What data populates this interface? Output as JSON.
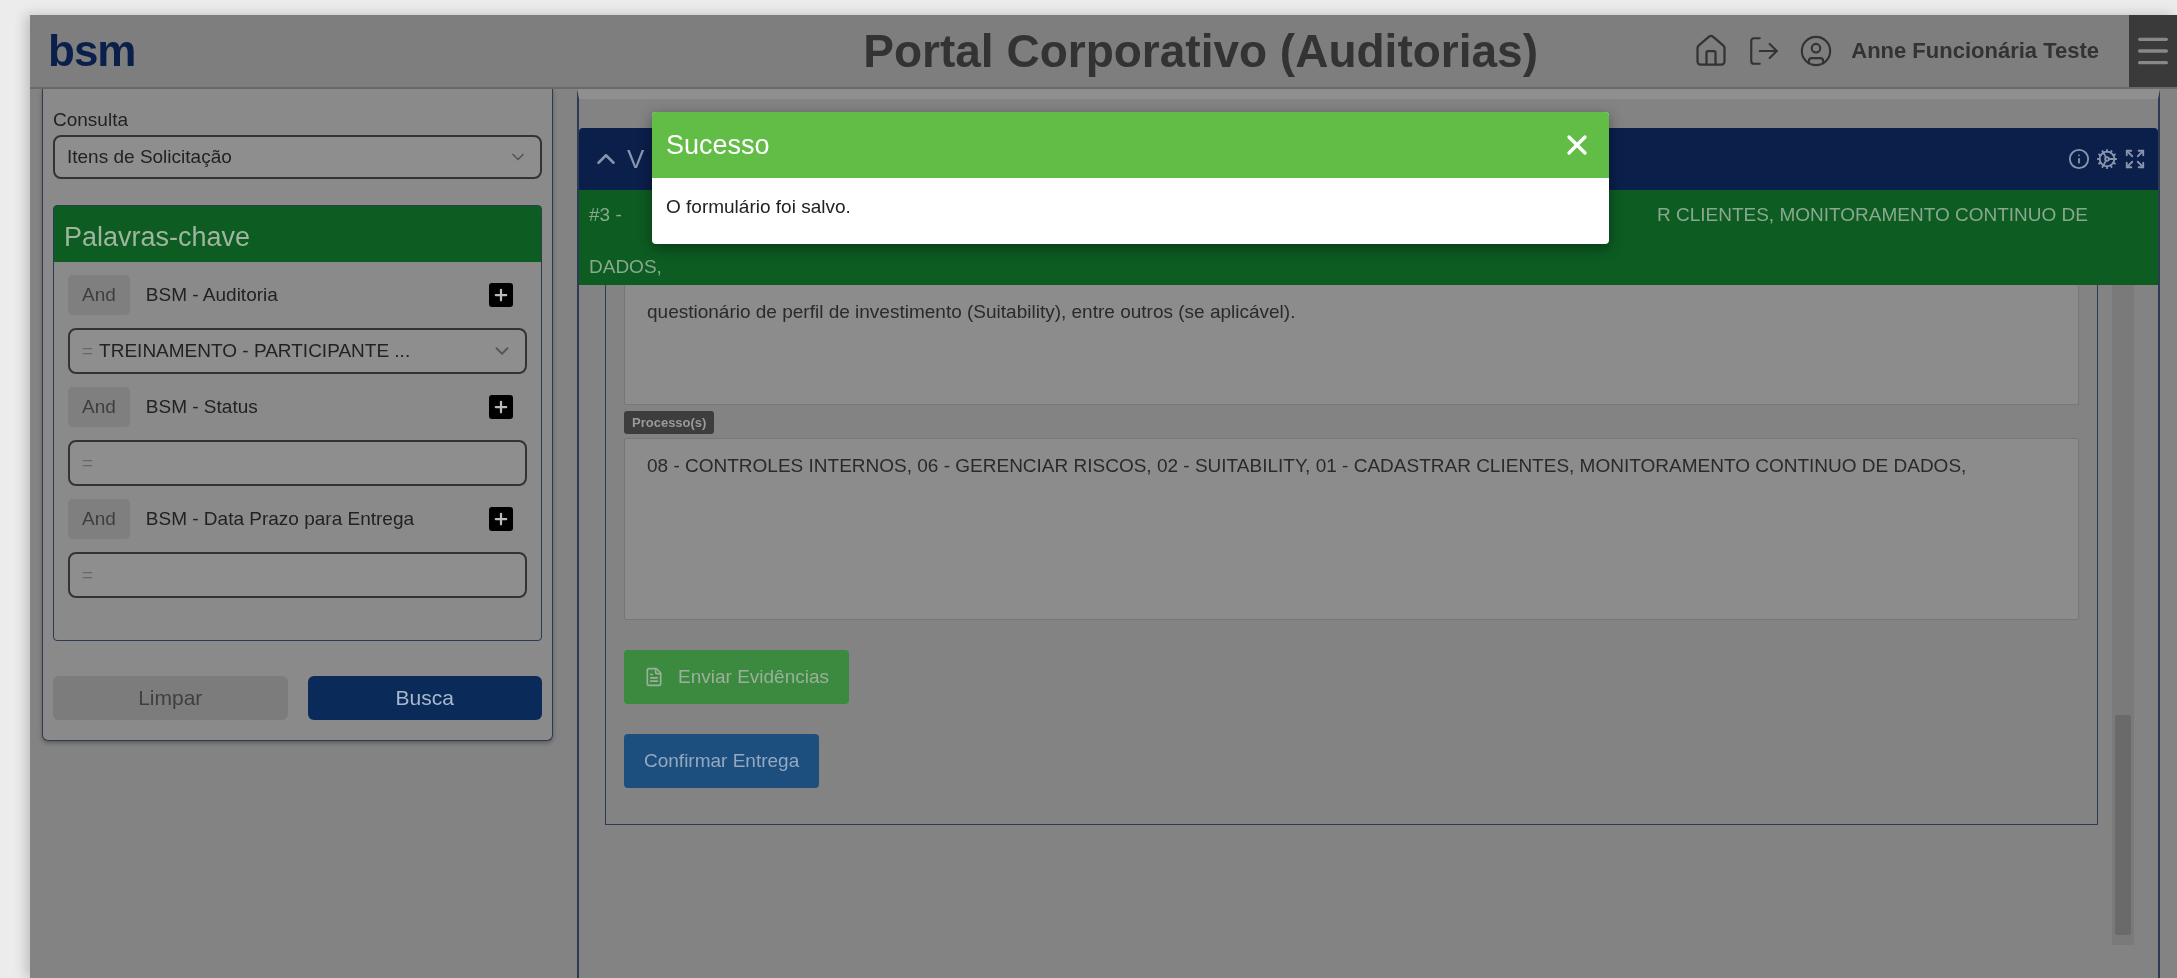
{
  "header": {
    "logo": "bsm",
    "title": "Portal Corporativo (Auditorias)",
    "user_name": "Anne Funcionária Teste"
  },
  "sidebar": {
    "query_label": "Consulta",
    "query_value": "Itens de Solicitação",
    "keywords_title": "Palavras-chave",
    "filters": [
      {
        "kind": "select",
        "operator": "And",
        "field": "BSM - Auditoria",
        "prefix": "=",
        "value": "TREINAMENTO - PARTICIPANTE ..."
      },
      {
        "kind": "input",
        "operator": "And",
        "field": "BSM - Status",
        "prefix": "="
      },
      {
        "kind": "input",
        "operator": "And",
        "field": "BSM - Data Prazo para Entrega",
        "prefix": "="
      }
    ],
    "buttons": [
      {
        "label": "Limpar",
        "disabled": true
      },
      {
        "label": "Busca",
        "disabled": false
      }
    ]
  },
  "panel": {
    "title_start": "V",
    "item_start": "#3 -",
    "item_end": "R CLIENTES, MONITORAMENTO CONTINUO DE",
    "item_line_2": "DADOS,",
    "description": "questionário de perfil de investimento (Suitability), entre outros (se aplicável).",
    "processes_label": "Processo(s)",
    "processes": "08 - CONTROLES INTERNOS, 06 - GERENCIAR RISCOS, 02 - SUITABILITY, 01 - CADASTRAR CLIENTES, MONITORAMENTO CONTINUO DE DADOS,",
    "send_button": "Enviar Evidências",
    "confirm_button": "Confirmar Entrega"
  },
  "modal": {
    "title": "Sucesso",
    "message": "O formulário foi salvo."
  }
}
